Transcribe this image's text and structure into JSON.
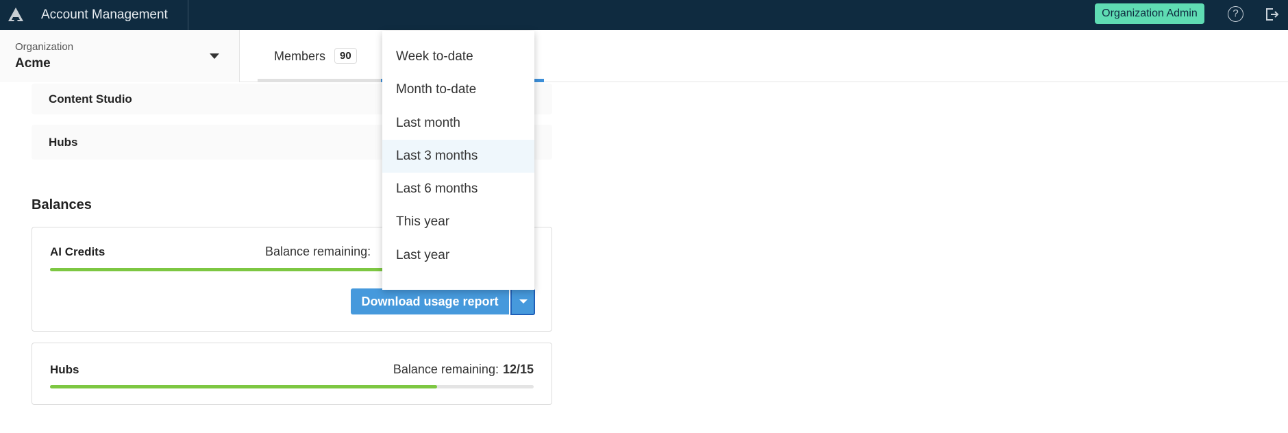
{
  "header": {
    "title": "Account Management",
    "role_badge": "Organization Admin",
    "help_icon": "help-circle-icon",
    "logout_icon": "logout-icon",
    "colors": {
      "bar": "#0f2b40",
      "badge": "#5fdcb3"
    }
  },
  "organization": {
    "label": "Organization",
    "value": "Acme"
  },
  "tabs": [
    {
      "label": "Members",
      "count": "90"
    }
  ],
  "products": [
    {
      "name": "Content Studio"
    },
    {
      "name": "Hubs"
    }
  ],
  "balances": {
    "heading": "Balances",
    "cards": [
      {
        "title": "AI Credits",
        "balance_label": "Balance remaining:",
        "download_label": "Download usage report"
      },
      {
        "title": "Hubs",
        "balance_label": "Balance remaining:",
        "balance_value": "12/15",
        "fill_fraction": 0.8
      }
    ]
  },
  "date_menu": {
    "items": [
      "Week to-date",
      "Month to-date",
      "Last month",
      "Last 3 months",
      "Last 6 months",
      "This year",
      "Last year"
    ],
    "highlighted": "Last 3 months"
  }
}
